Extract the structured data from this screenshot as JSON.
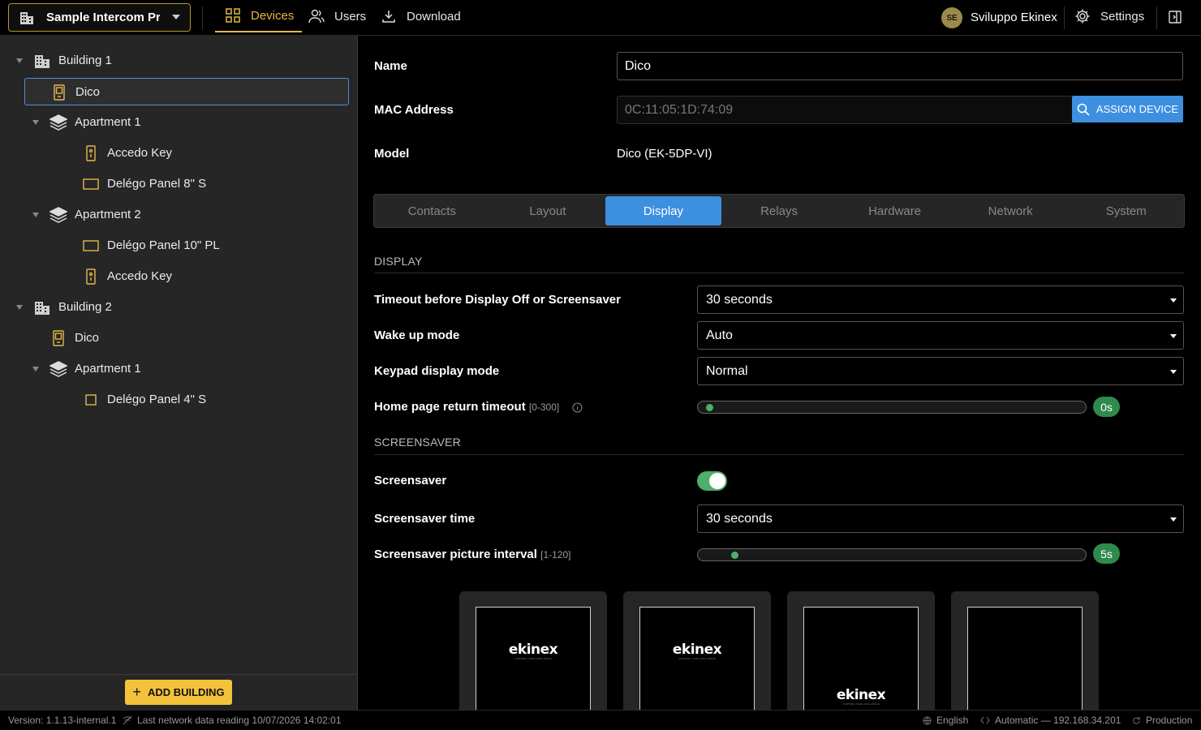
{
  "header": {
    "project_name": "Sample Intercom Proj...",
    "nav": {
      "devices": "Devices",
      "users": "Users",
      "download": "Download"
    },
    "user_initials": "SE",
    "user_name": "Sviluppo Ekinex",
    "settings": "Settings"
  },
  "tree": {
    "items": [
      {
        "label": "Building 1",
        "type": "building"
      },
      {
        "label": "Dico",
        "type": "dico"
      },
      {
        "label": "Apartment 1",
        "type": "apartment"
      },
      {
        "label": "Accedo Key",
        "type": "key"
      },
      {
        "label": "Delégo Panel 8\" S",
        "type": "panel"
      },
      {
        "label": "Apartment 2",
        "type": "apartment"
      },
      {
        "label": "Delégo Panel 10\" PL",
        "type": "panel"
      },
      {
        "label": "Accedo Key",
        "type": "key"
      },
      {
        "label": "Building 2",
        "type": "building"
      },
      {
        "label": "Dico",
        "type": "dico"
      },
      {
        "label": "Apartment 1",
        "type": "apartment"
      },
      {
        "label": "Delégo Panel 4\" S",
        "type": "panel-square"
      }
    ],
    "add_building": "ADD BUILDING"
  },
  "device": {
    "name_label": "Name",
    "name_value": "Dico",
    "mac_label": "MAC Address",
    "mac_placeholder": "0C:11:05:1D:74:09",
    "assign_button": "ASSIGN DEVICE",
    "model_label": "Model",
    "model_value": "Dico (EK-5DP-VI)"
  },
  "tabs": [
    "Contacts",
    "Layout",
    "Display",
    "Relays",
    "Hardware",
    "Network",
    "System"
  ],
  "active_tab": "Display",
  "display": {
    "section": "DISPLAY",
    "timeout_label": "Timeout before Display Off or Screensaver",
    "timeout_value": "30 seconds",
    "wake_label": "Wake up mode",
    "wake_value": "Auto",
    "keypad_label": "Keypad display mode",
    "keypad_value": "Normal",
    "home_label": "Home page return timeout",
    "home_range": "[0-300]",
    "home_value": "0s",
    "home_fraction": 0.0
  },
  "screensaver": {
    "section": "SCREENSAVER",
    "toggle_label": "Screensaver",
    "toggle_on": true,
    "time_label": "Screensaver time",
    "time_value": "30 seconds",
    "interval_label": "Screensaver picture interval",
    "interval_range": "[1-120]",
    "interval_value": "5s",
    "interval_fraction": 0.034,
    "logo_text": "ekinex",
    "logo_tagline": "CONTROL YOUR LIVING SPACE"
  },
  "status": {
    "version": "Version: 1.1.13-internal.1",
    "last_reading": "Last network data reading 10/07/2026 14:02:01",
    "language": "English",
    "connection": "Automatic — 192.168.34.201",
    "environment": "Production"
  }
}
